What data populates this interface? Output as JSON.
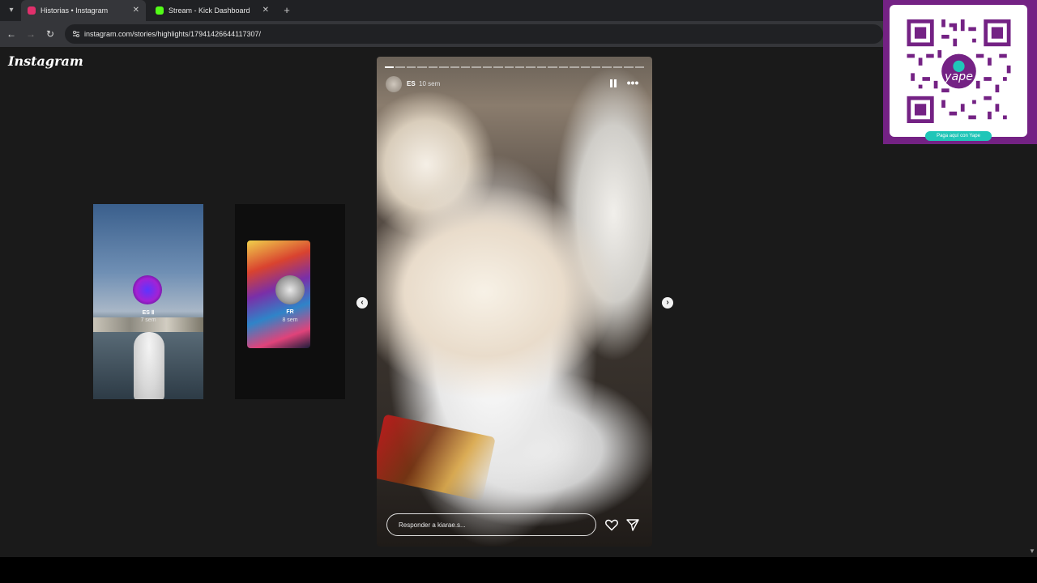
{
  "browser": {
    "tabs": [
      {
        "label": "Historias • Instagram",
        "active": true,
        "favicon_color": "#e1306c"
      },
      {
        "label": "Stream - Kick Dashboard",
        "active": false,
        "favicon_color": "#53fc18"
      }
    ],
    "url": "instagram.com/stories/highlights/17941426644117307/"
  },
  "page": {
    "logo": "Instagram",
    "previews": [
      {
        "user": "ES Ⅱ",
        "time": "7 sem"
      },
      {
        "user": "FR",
        "time": "8 sem"
      }
    ],
    "story": {
      "user": "ES",
      "time": "10 sem",
      "progress_segments": 24,
      "progress_done": 1,
      "reply_placeholder": "Responder a kiarae.s..."
    }
  },
  "overlay": {
    "badge": "Paga aquí con Yape",
    "qr_logo": "yape",
    "panel_color": "#742284"
  },
  "icons": [
    "tab-list-icon",
    "back-icon",
    "forward-icon",
    "reload-icon",
    "site-info-icon",
    "pause-icon",
    "more-icon",
    "heart-icon",
    "send-icon",
    "chevron-left-icon",
    "chevron-right-icon"
  ]
}
